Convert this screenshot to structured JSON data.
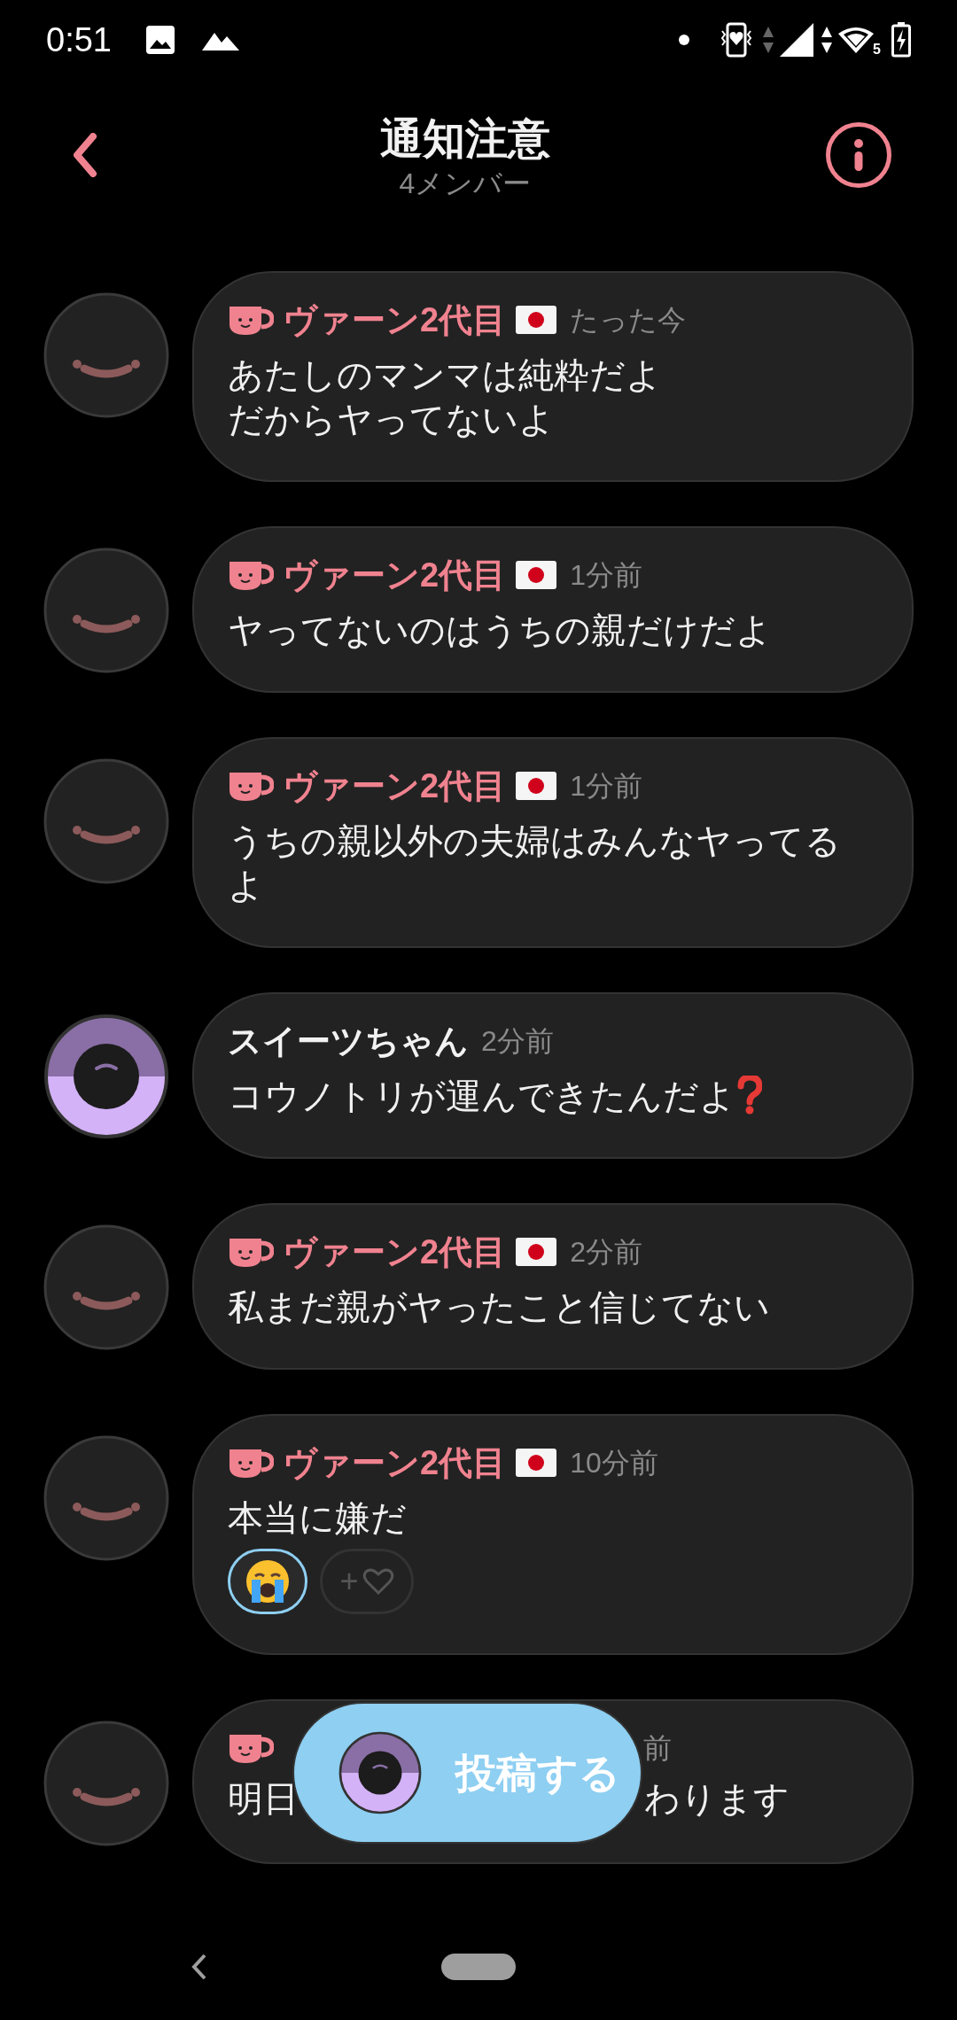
{
  "status_bar": {
    "time": "0:51",
    "wifi_badge": "5"
  },
  "header": {
    "title": "通知注意",
    "subtitle": "4メンバー"
  },
  "messages": [
    {
      "author": {
        "name": "ヴァーン2代目",
        "color": "#f0828f"
      },
      "cup_icon": true,
      "avatar": {
        "kind": "dark"
      },
      "flag": true,
      "time": "たった今",
      "lines": [
        "あたしのマンマは純粋だよ",
        "だからヤってないよ"
      ]
    },
    {
      "author": {
        "name": "ヴァーン2代目",
        "color": "#f0828f"
      },
      "cup_icon": true,
      "avatar": {
        "kind": "dark"
      },
      "flag": true,
      "time": "1分前",
      "lines": [
        "ヤってないのはうちの親だけだよ"
      ]
    },
    {
      "author": {
        "name": "ヴァーン2代目",
        "color": "#f0828f"
      },
      "cup_icon": true,
      "avatar": {
        "kind": "dark"
      },
      "flag": true,
      "time": "1分前",
      "lines": [
        "うちの親以外の夫婦はみんなヤってる",
        "よ"
      ]
    },
    {
      "author": {
        "name": "スイーツちゃん",
        "color": "#f2f2f2"
      },
      "cup_icon": false,
      "avatar": {
        "kind": "purple"
      },
      "flag": false,
      "time": "2分前",
      "lines": [
        "コウノトリが運んできたんだよ"
      ],
      "question_mark": true
    },
    {
      "author": {
        "name": "ヴァーン2代目",
        "color": "#f0828f"
      },
      "cup_icon": true,
      "avatar": {
        "kind": "dark"
      },
      "flag": true,
      "time": "2分前",
      "lines": [
        "私まだ親がヤったこと信じてない"
      ]
    },
    {
      "author": {
        "name": "ヴァーン2代目",
        "color": "#f0828f"
      },
      "cup_icon": true,
      "avatar": {
        "kind": "dark"
      },
      "flag": true,
      "time": "10分前",
      "lines": [
        "本当に嫌だ"
      ],
      "reactions": [
        {
          "kind": "emoji",
          "selected": true
        },
        {
          "kind": "add",
          "label": "+",
          "selected": false
        }
      ]
    }
  ],
  "covered_message": {
    "cup_icon": true,
    "avatar": {
      "kind": "dark"
    },
    "time_fragment": "前",
    "text_start": "明日",
    "text_end": "わります"
  },
  "post_button": {
    "label": "投稿する",
    "avatar": {
      "kind": "purple"
    }
  }
}
